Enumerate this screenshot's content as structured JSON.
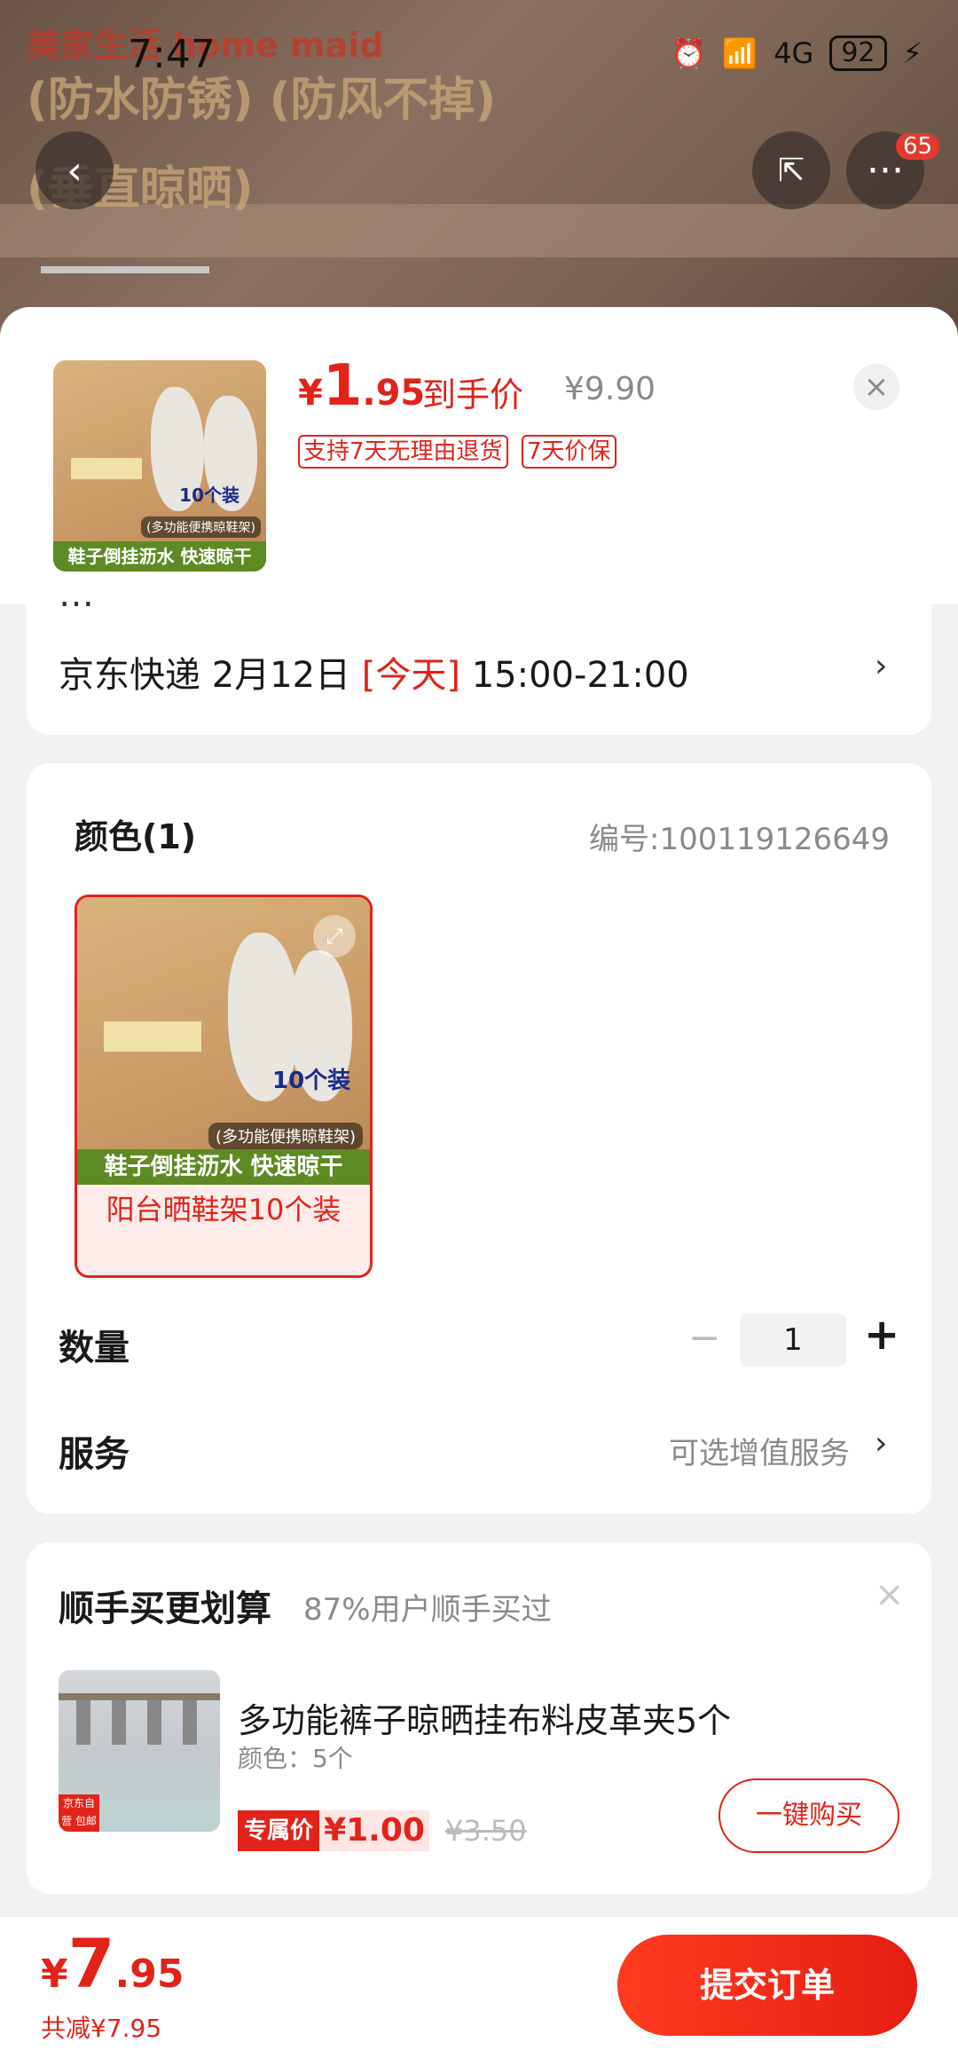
{
  "status_bar": {
    "time": "7:47",
    "battery": "92",
    "signal": "4G"
  },
  "background": {
    "text_line1": "(防水防锈) (防风不掉)",
    "text_line2": "(垂直晾晒)",
    "watermark": "美家生活 home maid"
  },
  "top_actions": {
    "badge_count": "65"
  },
  "product": {
    "price_symbol": "¥",
    "price_int": "1",
    "price_dec": ".95",
    "price_label": "到手价",
    "original_price": "¥9.90",
    "tags": [
      "支持7天无理由退货",
      "7天价保"
    ],
    "thumb_caption": "鞋子倒挂沥水 快速晾干",
    "thumb_pack": "10个装",
    "thumb_note": "(多功能便携晾鞋架)"
  },
  "delivery": {
    "address_partial": "…",
    "carrier": "京东快递",
    "date": "2月12日",
    "today": "[今天]",
    "time": "15:00-21:00"
  },
  "spec": {
    "color_title": "颜色(1)",
    "sku": "编号:100119126649",
    "variant_name": "阳台晒鞋架10个装",
    "variant_caption": "鞋子倒挂沥水 快速晾干",
    "variant_pack": "10个装",
    "variant_note": "(多功能便携晾鞋架)",
    "qty_label": "数量",
    "qty_value": "1",
    "service_label": "服务",
    "service_value": "可选增值服务"
  },
  "addon": {
    "title": "顺手买更划算",
    "subtitle": "87%用户顺手买过",
    "item_name": "多功能裤子晾晒挂布料皮革夹5个",
    "item_spec": "颜色：5个",
    "exclusive_label": "专属价",
    "exclusive_price": "¥1.00",
    "original_price": "¥3.50",
    "buy_button": "一键购买",
    "thumb_badge": "京东自营 包邮"
  },
  "footer": {
    "total_symbol": "¥",
    "total_int": "7",
    "total_dec": ".95",
    "discount": "共减¥7.95",
    "submit": "提交订单"
  }
}
